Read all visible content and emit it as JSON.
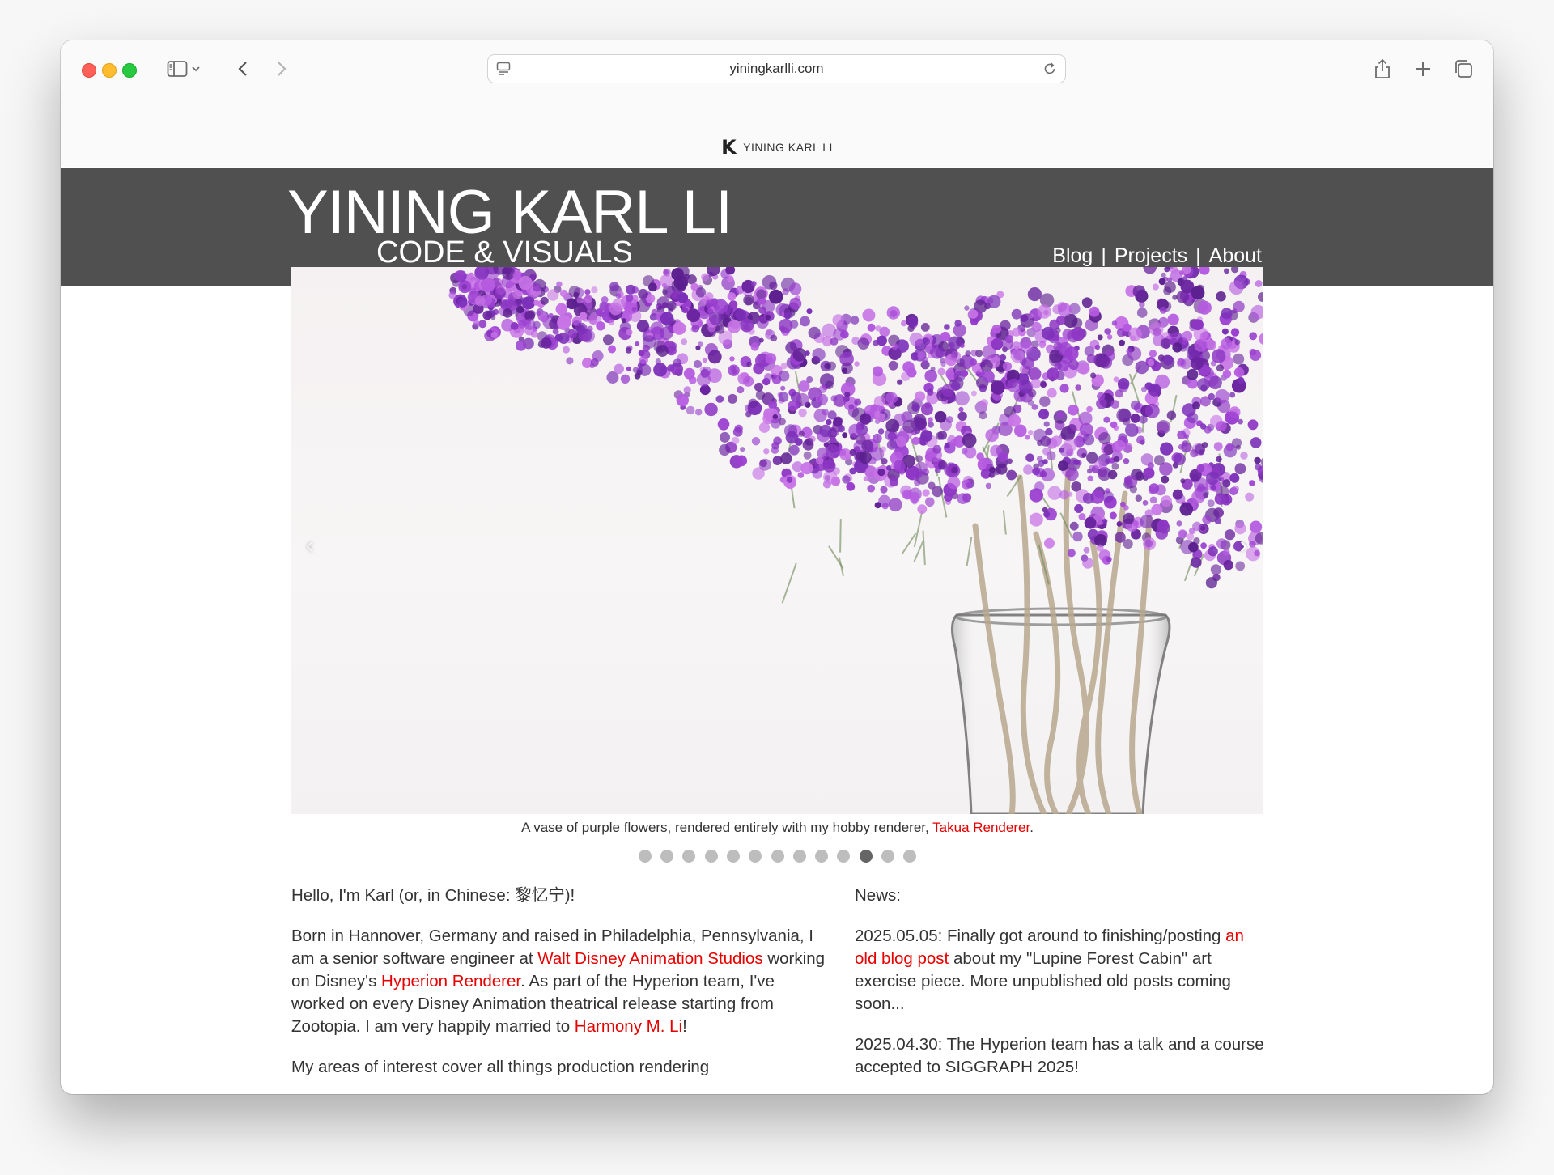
{
  "browser": {
    "url": "yiningkarlli.com",
    "tab_title": "YINING KARL LI",
    "tab_favicon": "K"
  },
  "site": {
    "title": "YINING KARL LI",
    "subtitle": "CODE & VISUALS",
    "nav": [
      {
        "label": "Blog"
      },
      {
        "label": "Projects"
      },
      {
        "label": "About"
      }
    ],
    "nav_separator": "|"
  },
  "slideshow": {
    "prev_arrow": "‹",
    "next_arrow": "›",
    "caption_prefix": "A vase of purple flowers, rendered entirely with my hobby renderer, ",
    "caption_link": "Takua Renderer",
    "caption_suffix": ".",
    "slide_count": 13,
    "active_slide": 11
  },
  "intro": {
    "greeting": "Hello, I'm Karl (or, in Chinese: 黎忆宁)!",
    "bio_1": "Born in Hannover, Germany and raised in Philadelphia, Pennsylvania, I am a senior software engineer at ",
    "bio_link_1": "Walt Disney Animation Studios",
    "bio_2": " working on Disney's ",
    "bio_link_2": "Hyperion Renderer",
    "bio_3": ". As part of the Hyperion team, I've worked on every Disney Animation theatrical release starting from Zootopia. I am very happily married to ",
    "bio_link_3": "Harmony M. Li",
    "bio_4": "!",
    "interests_partial": "My areas of interest cover all things production rendering"
  },
  "news": {
    "heading": "News:",
    "items": [
      {
        "date_text": "2025.05.05: Finally got around to finishing/posting ",
        "link": "an old blog post",
        "rest": " about my \"Lupine Forest Cabin\" art exercise piece. More unpublished old posts coming soon..."
      },
      {
        "date_text": "2025.04.30: The Hyperion team has a talk and a course accepted to SIGGRAPH 2025!"
      }
    ]
  },
  "colors": {
    "header_bg": "#505050",
    "link": "#e60000",
    "dot_active": "#656565",
    "dot_inactive": "#bdbdbd"
  }
}
